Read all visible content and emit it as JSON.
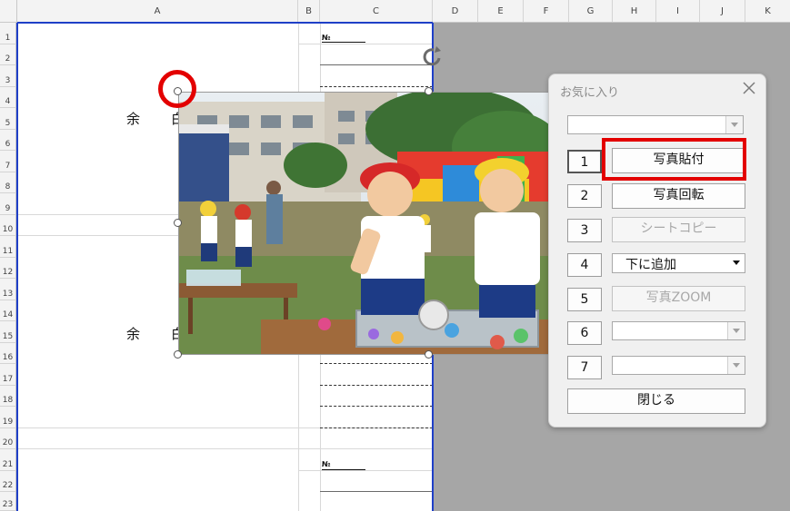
{
  "spreadsheet": {
    "columns": [
      "A",
      "B",
      "C",
      "D",
      "E",
      "F",
      "G",
      "H",
      "I",
      "J",
      "K"
    ],
    "rows": [
      "1",
      "2",
      "3",
      "4",
      "5",
      "6",
      "7",
      "8",
      "9",
      "10",
      "11",
      "12",
      "13",
      "14",
      "15",
      "16",
      "17",
      "18",
      "19",
      "20",
      "21",
      "22",
      "23"
    ],
    "cells": {
      "yoha_1": "余",
      "b_1": "白",
      "yoha_2": "余",
      "b_2": "白",
      "no_1": "№",
      "no_2": "№"
    }
  },
  "photo": {
    "description_icon": "photo-image"
  },
  "dialog": {
    "title": "お気に入り",
    "close_icon": "close-icon",
    "top_combo_value": "",
    "rows": [
      {
        "number": "1",
        "label": "写真貼付",
        "enabled": true
      },
      {
        "number": "2",
        "label": "写真回転",
        "enabled": true
      },
      {
        "number": "3",
        "label": "シートコピー",
        "enabled": false
      },
      {
        "number": "4",
        "label": "下に追加",
        "enabled": true
      },
      {
        "number": "5",
        "label": "写真ZOOM",
        "enabled": false
      },
      {
        "number": "6",
        "label": "",
        "enabled": false
      },
      {
        "number": "7",
        "label": "",
        "enabled": false
      }
    ],
    "close_button": "閉じる"
  },
  "colors": {
    "highlight_red": "#e30000",
    "page_border_blue": "#1f3fc7"
  }
}
